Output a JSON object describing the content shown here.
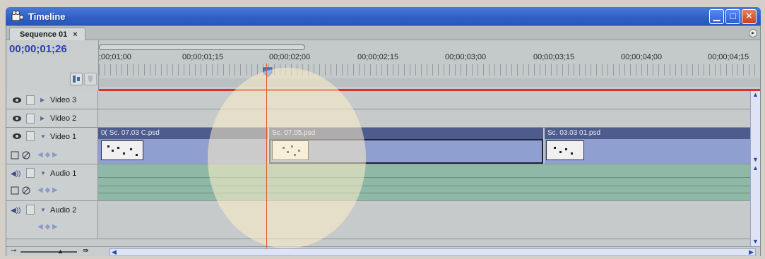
{
  "window": {
    "title": "Timeline",
    "icons": {
      "app": "film-icon",
      "minimize": "minimize-icon",
      "maximize": "maximize-icon",
      "close": "close-icon"
    }
  },
  "tab": {
    "label": "Sequence 01",
    "close": "×"
  },
  "timecode": "00;00;01;26",
  "ruler": {
    "labels": [
      ";00;01;00",
      "00;00;01;15",
      "00;00;02;00",
      "00;00;02;15",
      "00;00;03;00",
      "00;00;03;15",
      "00;00;04;00",
      "00;00;04;15"
    ]
  },
  "tracks": {
    "video3": {
      "name": "Video 3"
    },
    "video2": {
      "name": "Video 2"
    },
    "video1": {
      "name": "Video 1"
    },
    "audio1": {
      "name": "Audio 1"
    },
    "audio2": {
      "name": "Audio 2"
    }
  },
  "clips": [
    {
      "label": "0( Sc. 07.03 C.psd"
    },
    {
      "label": "Sc. 07.05.psd"
    },
    {
      "label": "Sc. 03.03 01.psd"
    }
  ],
  "colors": {
    "accent": "#2f5fc6",
    "clip_header": "#4d5c8c",
    "clip_body": "#8e9fd0",
    "audio_lane": "#8fb9a6",
    "playhead": "#e0512a",
    "timecode": "#2b3fb0"
  }
}
